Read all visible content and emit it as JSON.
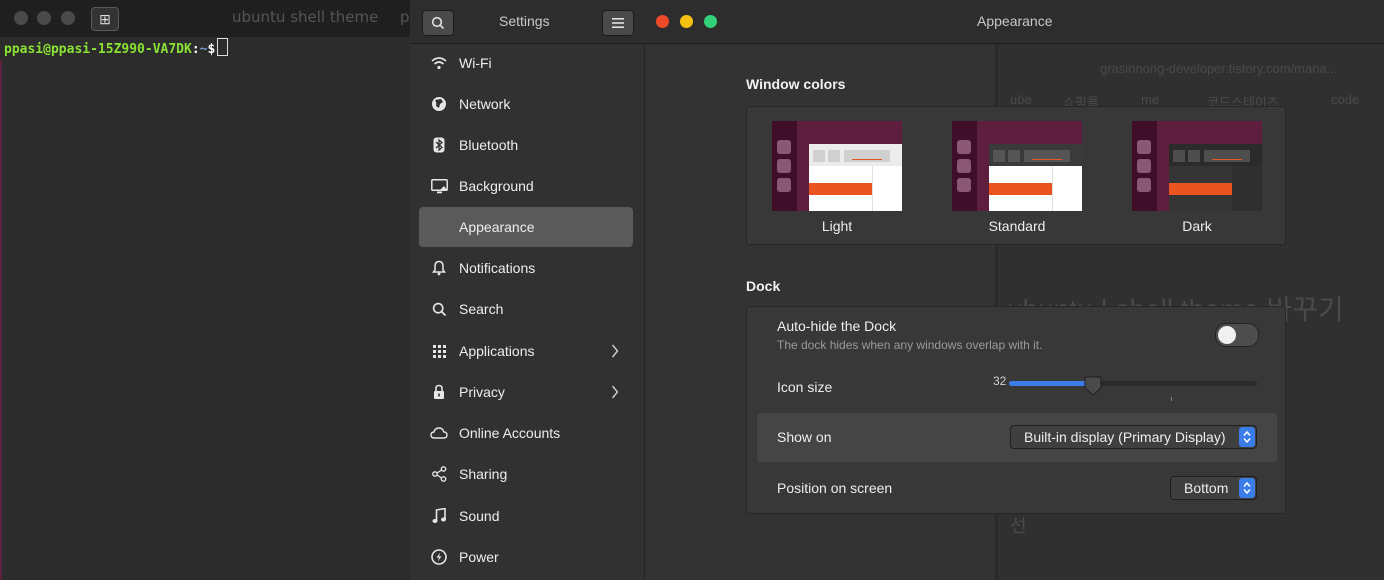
{
  "terminal": {
    "new_tab_icon": "new-tab-icon",
    "prompt_user": "ppasi@ppasi-15Z990-VA7DK",
    "prompt_colon": ":",
    "prompt_path": "~",
    "prompt_symbol": "$",
    "background_tab_title": "ubuntu shell theme",
    "background_tab_partial": "p"
  },
  "settings": {
    "header": {
      "search_icon": "search-icon",
      "title": "Settings",
      "menu_icon": "hamburger-menu-icon",
      "page_title": "Appearance",
      "window_controls": {
        "close": "#ee4b2b",
        "minimize": "#f5c211",
        "maximize": "#33d17a"
      }
    },
    "sidebar": {
      "items": [
        {
          "label": "Wi-Fi",
          "icon": "wifi-icon"
        },
        {
          "label": "Network",
          "icon": "globe-icon"
        },
        {
          "label": "Bluetooth",
          "icon": "bluetooth-icon"
        },
        {
          "label": "Background",
          "icon": "monitor-icon"
        },
        {
          "label": "Appearance",
          "icon": "",
          "active": true
        },
        {
          "label": "Notifications",
          "icon": "bell-icon"
        },
        {
          "label": "Search",
          "icon": "search-icon"
        },
        {
          "label": "Applications",
          "icon": "grid-icon",
          "has_submenu": true
        },
        {
          "label": "Privacy",
          "icon": "lock-icon",
          "has_submenu": true
        },
        {
          "label": "Online Accounts",
          "icon": "cloud-icon"
        },
        {
          "label": "Sharing",
          "icon": "share-icon"
        },
        {
          "label": "Sound",
          "icon": "music-note-icon"
        },
        {
          "label": "Power",
          "icon": "power-icon"
        }
      ]
    },
    "window_colors": {
      "title": "Window colors",
      "themes": [
        {
          "label": "Light"
        },
        {
          "label": "Standard"
        },
        {
          "label": "Dark"
        }
      ]
    },
    "dock": {
      "title": "Dock",
      "autohide_label": "Auto-hide the Dock",
      "autohide_sub": "The dock hides when any windows overlap with it.",
      "autohide_on": false,
      "icon_size_label": "Icon size",
      "icon_size_value": "32",
      "icon_size_fraction": 0.34,
      "show_on_label": "Show on",
      "show_on_value": "Built-in display (Primary Display)",
      "position_label": "Position on screen",
      "position_value": "Bottom"
    },
    "background_browser_ghost": {
      "url": "grasinnong-developer.tistory.com/mana...",
      "bookmarks": [
        "ube",
        "쇼핑몰",
        "me",
        "코드스테이츠",
        "code"
      ],
      "heading": "ubuntu | shell theme 바꾸기",
      "fragment": "선"
    }
  },
  "colors": {
    "accent": "#3b7de8",
    "ubuntu_aubergine": "#5e1f3f",
    "ubuntu_orange": "#e95420"
  }
}
